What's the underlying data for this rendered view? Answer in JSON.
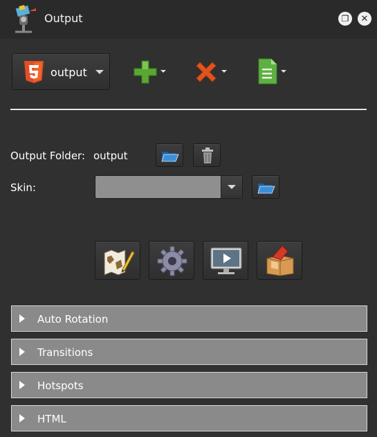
{
  "window": {
    "title": "Output"
  },
  "toolbar": {
    "preset_label": "output",
    "preset_icon": "html5-icon",
    "add_icon": "plus-icon",
    "remove_icon": "x-icon",
    "document_icon": "document-icon"
  },
  "settings": {
    "output_folder_label": "Output Folder:",
    "output_folder_value": "output",
    "skin_label": "Skin:",
    "skin_value": ""
  },
  "actions": [
    {
      "name": "map-edit-button",
      "icon": "map-pencil-icon"
    },
    {
      "name": "settings-button",
      "icon": "gear-icon"
    },
    {
      "name": "preview-button",
      "icon": "monitor-play-icon"
    },
    {
      "name": "package-button",
      "icon": "box-icon"
    }
  ],
  "sections": [
    {
      "label": "Auto Rotation"
    },
    {
      "label": "Transitions"
    },
    {
      "label": "Hotspots"
    },
    {
      "label": "HTML"
    }
  ],
  "colors": {
    "html5": "#e44d26",
    "add": "#5aa832",
    "remove": "#e0541e",
    "document": "#5fb043",
    "folder": "#3b8fd8"
  }
}
